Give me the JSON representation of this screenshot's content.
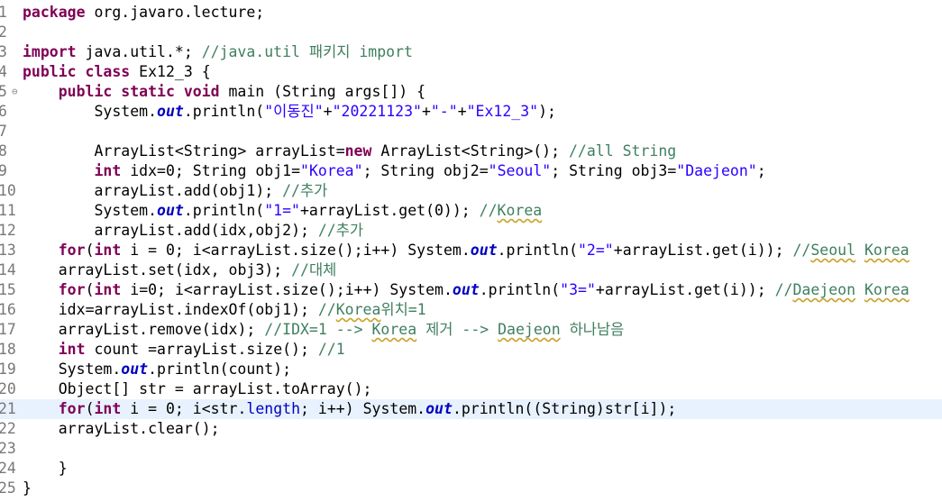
{
  "editor": {
    "current_line": 21,
    "fold_marker_line": 5,
    "lines": [
      {
        "num": "1",
        "tokens": [
          {
            "t": "kw",
            "v": "package"
          },
          {
            "t": "tx",
            "v": " org.javaro.lecture;"
          }
        ]
      },
      {
        "num": "2",
        "tokens": []
      },
      {
        "num": "3",
        "tokens": [
          {
            "t": "kw",
            "v": "import"
          },
          {
            "t": "tx",
            "v": " java.util.*; "
          },
          {
            "t": "cm",
            "v": "//java.util 패키지 import"
          }
        ]
      },
      {
        "num": "4",
        "tokens": [
          {
            "t": "kw",
            "v": "public class"
          },
          {
            "t": "tx",
            "v": " Ex12_3 {"
          }
        ]
      },
      {
        "num": "5",
        "tokens": [
          {
            "t": "tx",
            "v": "    "
          },
          {
            "t": "kw",
            "v": "public static void"
          },
          {
            "t": "tx",
            "v": " main (String "
          },
          {
            "t": "var",
            "v": "args"
          },
          {
            "t": "tx",
            "v": "[]) {"
          }
        ]
      },
      {
        "num": "6",
        "tokens": [
          {
            "t": "tx",
            "v": "        System."
          },
          {
            "t": "st",
            "v": "out"
          },
          {
            "t": "tx",
            "v": ".println("
          },
          {
            "t": "str",
            "v": "\"이동진\""
          },
          {
            "t": "tx",
            "v": "+"
          },
          {
            "t": "str",
            "v": "\"20221123\""
          },
          {
            "t": "tx",
            "v": "+"
          },
          {
            "t": "str",
            "v": "\"-\""
          },
          {
            "t": "tx",
            "v": "+"
          },
          {
            "t": "str",
            "v": "\"Ex12_3\""
          },
          {
            "t": "tx",
            "v": ");"
          }
        ]
      },
      {
        "num": "7",
        "tokens": []
      },
      {
        "num": "8",
        "tokens": [
          {
            "t": "tx",
            "v": "        ArrayList<String> "
          },
          {
            "t": "var",
            "v": "arrayList"
          },
          {
            "t": "tx",
            "v": "="
          },
          {
            "t": "kw",
            "v": "new"
          },
          {
            "t": "tx",
            "v": " ArrayList<String>(); "
          },
          {
            "t": "cm",
            "v": "//all String"
          }
        ]
      },
      {
        "num": "9",
        "tokens": [
          {
            "t": "tx",
            "v": "        "
          },
          {
            "t": "kw",
            "v": "int"
          },
          {
            "t": "tx",
            "v": " "
          },
          {
            "t": "var",
            "v": "idx"
          },
          {
            "t": "tx",
            "v": "=0; String "
          },
          {
            "t": "var",
            "v": "obj1"
          },
          {
            "t": "tx",
            "v": "="
          },
          {
            "t": "str",
            "v": "\"Korea\""
          },
          {
            "t": "tx",
            "v": "; String "
          },
          {
            "t": "var",
            "v": "obj2"
          },
          {
            "t": "tx",
            "v": "="
          },
          {
            "t": "str",
            "v": "\"Seoul\""
          },
          {
            "t": "tx",
            "v": "; String "
          },
          {
            "t": "var",
            "v": "obj3"
          },
          {
            "t": "tx",
            "v": "="
          },
          {
            "t": "str",
            "v": "\"Daejeon\""
          },
          {
            "t": "tx",
            "v": ";"
          }
        ]
      },
      {
        "num": "10",
        "tokens": [
          {
            "t": "tx",
            "v": "        "
          },
          {
            "t": "var",
            "v": "arrayList"
          },
          {
            "t": "tx",
            "v": ".add("
          },
          {
            "t": "var",
            "v": "obj1"
          },
          {
            "t": "tx",
            "v": "); "
          },
          {
            "t": "cm",
            "v": "//추가"
          }
        ]
      },
      {
        "num": "11",
        "tokens": [
          {
            "t": "tx",
            "v": "        System."
          },
          {
            "t": "st",
            "v": "out"
          },
          {
            "t": "tx",
            "v": ".println("
          },
          {
            "t": "str",
            "v": "\"1=\""
          },
          {
            "t": "tx",
            "v": "+"
          },
          {
            "t": "var",
            "v": "arrayList"
          },
          {
            "t": "tx",
            "v": ".get(0)); "
          },
          {
            "t": "cm",
            "v": "//"
          },
          {
            "t": "cmsq",
            "v": "Korea"
          }
        ]
      },
      {
        "num": "12",
        "tokens": [
          {
            "t": "tx",
            "v": "        "
          },
          {
            "t": "var",
            "v": "arrayList"
          },
          {
            "t": "tx",
            "v": ".add("
          },
          {
            "t": "var",
            "v": "idx"
          },
          {
            "t": "tx",
            "v": ","
          },
          {
            "t": "var",
            "v": "obj2"
          },
          {
            "t": "tx",
            "v": "); "
          },
          {
            "t": "cm",
            "v": "//추가"
          }
        ]
      },
      {
        "num": "13",
        "tokens": [
          {
            "t": "tx",
            "v": "    "
          },
          {
            "t": "kw",
            "v": "for"
          },
          {
            "t": "tx",
            "v": "("
          },
          {
            "t": "kw",
            "v": "int"
          },
          {
            "t": "tx",
            "v": " "
          },
          {
            "t": "var",
            "v": "i"
          },
          {
            "t": "tx",
            "v": " = 0; "
          },
          {
            "t": "var",
            "v": "i"
          },
          {
            "t": "tx",
            "v": "<"
          },
          {
            "t": "var",
            "v": "arrayList"
          },
          {
            "t": "tx",
            "v": ".size();"
          },
          {
            "t": "var",
            "v": "i"
          },
          {
            "t": "tx",
            "v": "++) System."
          },
          {
            "t": "st",
            "v": "out"
          },
          {
            "t": "tx",
            "v": ".println("
          },
          {
            "t": "str",
            "v": "\"2=\""
          },
          {
            "t": "tx",
            "v": "+"
          },
          {
            "t": "var",
            "v": "arrayList"
          },
          {
            "t": "tx",
            "v": ".get("
          },
          {
            "t": "var",
            "v": "i"
          },
          {
            "t": "tx",
            "v": ")); "
          },
          {
            "t": "cm",
            "v": "//"
          },
          {
            "t": "cmsq",
            "v": "Seoul"
          },
          {
            "t": "cm",
            "v": " "
          },
          {
            "t": "cmsq",
            "v": "Korea"
          }
        ]
      },
      {
        "num": "14",
        "tokens": [
          {
            "t": "tx",
            "v": "    "
          },
          {
            "t": "var",
            "v": "arrayList"
          },
          {
            "t": "tx",
            "v": ".set("
          },
          {
            "t": "var",
            "v": "idx"
          },
          {
            "t": "tx",
            "v": ", "
          },
          {
            "t": "var",
            "v": "obj3"
          },
          {
            "t": "tx",
            "v": "); "
          },
          {
            "t": "cm",
            "v": "//대체"
          }
        ]
      },
      {
        "num": "15",
        "tokens": [
          {
            "t": "tx",
            "v": "    "
          },
          {
            "t": "kw",
            "v": "for"
          },
          {
            "t": "tx",
            "v": "("
          },
          {
            "t": "kw",
            "v": "int"
          },
          {
            "t": "tx",
            "v": " "
          },
          {
            "t": "var",
            "v": "i"
          },
          {
            "t": "tx",
            "v": "=0; "
          },
          {
            "t": "var",
            "v": "i"
          },
          {
            "t": "tx",
            "v": "<"
          },
          {
            "t": "var",
            "v": "arrayList"
          },
          {
            "t": "tx",
            "v": ".size();"
          },
          {
            "t": "var",
            "v": "i"
          },
          {
            "t": "tx",
            "v": "++) System."
          },
          {
            "t": "st",
            "v": "out"
          },
          {
            "t": "tx",
            "v": ".println("
          },
          {
            "t": "str",
            "v": "\"3=\""
          },
          {
            "t": "tx",
            "v": "+"
          },
          {
            "t": "var",
            "v": "arrayList"
          },
          {
            "t": "tx",
            "v": ".get("
          },
          {
            "t": "var",
            "v": "i"
          },
          {
            "t": "tx",
            "v": ")); "
          },
          {
            "t": "cm",
            "v": "//"
          },
          {
            "t": "cmsq",
            "v": "Daejeon"
          },
          {
            "t": "cm",
            "v": " "
          },
          {
            "t": "cmsq",
            "v": "Korea"
          }
        ]
      },
      {
        "num": "16",
        "tokens": [
          {
            "t": "tx",
            "v": "    "
          },
          {
            "t": "var",
            "v": "idx"
          },
          {
            "t": "tx",
            "v": "="
          },
          {
            "t": "var",
            "v": "arrayList"
          },
          {
            "t": "tx",
            "v": ".indexOf("
          },
          {
            "t": "var",
            "v": "obj1"
          },
          {
            "t": "tx",
            "v": "); "
          },
          {
            "t": "cm",
            "v": "//"
          },
          {
            "t": "cmsq",
            "v": "Korea"
          },
          {
            "t": "cm",
            "v": "위치=1"
          }
        ]
      },
      {
        "num": "17",
        "tokens": [
          {
            "t": "tx",
            "v": "    "
          },
          {
            "t": "var",
            "v": "arrayList"
          },
          {
            "t": "tx",
            "v": ".remove("
          },
          {
            "t": "var",
            "v": "idx"
          },
          {
            "t": "tx",
            "v": "); "
          },
          {
            "t": "cm",
            "v": "//IDX=1 --> "
          },
          {
            "t": "cmsq",
            "v": "Korea"
          },
          {
            "t": "cm",
            "v": " 제거 --> "
          },
          {
            "t": "cmsq",
            "v": "Daejeon"
          },
          {
            "t": "cm",
            "v": " 하나남음"
          }
        ]
      },
      {
        "num": "18",
        "tokens": [
          {
            "t": "tx",
            "v": "    "
          },
          {
            "t": "kw",
            "v": "int"
          },
          {
            "t": "tx",
            "v": " "
          },
          {
            "t": "var",
            "v": "count"
          },
          {
            "t": "tx",
            "v": " ="
          },
          {
            "t": "var",
            "v": "arrayList"
          },
          {
            "t": "tx",
            "v": ".size(); "
          },
          {
            "t": "cm",
            "v": "//1"
          }
        ]
      },
      {
        "num": "19",
        "tokens": [
          {
            "t": "tx",
            "v": "    System."
          },
          {
            "t": "st",
            "v": "out"
          },
          {
            "t": "tx",
            "v": ".println("
          },
          {
            "t": "var",
            "v": "count"
          },
          {
            "t": "tx",
            "v": ");"
          }
        ]
      },
      {
        "num": "20",
        "tokens": [
          {
            "t": "tx",
            "v": "    Object[] "
          },
          {
            "t": "var",
            "v": "str"
          },
          {
            "t": "tx",
            "v": " = "
          },
          {
            "t": "var",
            "v": "arrayList"
          },
          {
            "t": "tx",
            "v": ".toArray();"
          }
        ]
      },
      {
        "num": "21",
        "tokens": [
          {
            "t": "tx",
            "v": "    "
          },
          {
            "t": "kw",
            "v": "for"
          },
          {
            "t": "tx",
            "v": "("
          },
          {
            "t": "kw",
            "v": "int"
          },
          {
            "t": "tx",
            "v": " "
          },
          {
            "t": "var",
            "v": "i"
          },
          {
            "t": "tx",
            "v": " = 0; "
          },
          {
            "t": "var",
            "v": "i"
          },
          {
            "t": "tx",
            "v": "<"
          },
          {
            "t": "var",
            "v": "str"
          },
          {
            "t": "tx",
            "v": "."
          },
          {
            "t": "fld",
            "v": "length"
          },
          {
            "t": "tx",
            "v": "; "
          },
          {
            "t": "var",
            "v": "i"
          },
          {
            "t": "tx",
            "v": "++) System."
          },
          {
            "t": "st",
            "v": "out"
          },
          {
            "t": "tx",
            "v": ".println((String)"
          },
          {
            "t": "var",
            "v": "str"
          },
          {
            "t": "tx",
            "v": "["
          },
          {
            "t": "var",
            "v": "i"
          },
          {
            "t": "tx",
            "v": "]);"
          }
        ]
      },
      {
        "num": "22",
        "tokens": [
          {
            "t": "tx",
            "v": "    "
          },
          {
            "t": "var",
            "v": "arrayList"
          },
          {
            "t": "tx",
            "v": ".clear();"
          }
        ]
      },
      {
        "num": "23",
        "tokens": []
      },
      {
        "num": "24",
        "tokens": [
          {
            "t": "tx",
            "v": "    }"
          }
        ]
      },
      {
        "num": "25",
        "tokens": [
          {
            "t": "tx",
            "v": "}"
          }
        ]
      }
    ]
  }
}
